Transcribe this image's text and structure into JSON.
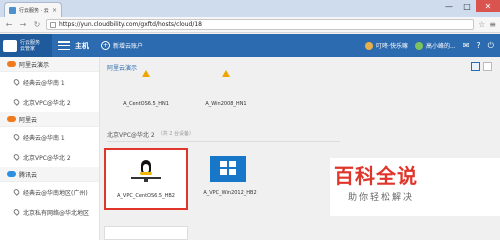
{
  "browser": {
    "tab_title": "行云服务 · 云管家",
    "tab_close": "×",
    "url": "https://yun.cloudbility.com/gxftd/hosts/cloud/18",
    "window_controls": [
      "—",
      "□",
      "✕"
    ],
    "icons": {
      "back": "back-arrow-icon",
      "forward": "forward-arrow-icon",
      "reload": "reload-icon",
      "bookmark": "star-icon",
      "menu": "menu-icon"
    }
  },
  "app": {
    "logo_text_1": "行云服务",
    "logo_text_2": "云管家",
    "host_label": "主机",
    "new_host": "新增云账户",
    "user_label": "叮咚·快乐嘛",
    "account_label": "高小峰的...",
    "notify_icon": "mail-icon",
    "help_icon": "help-icon",
    "power_icon": "power-icon"
  },
  "sidebar": {
    "groups": [
      {
        "label": "阿里云演示",
        "color": "#f07a1e",
        "items": [
          {
            "label": "经典云@华南 1"
          },
          {
            "label": "北京VPC@华北 2"
          }
        ]
      },
      {
        "label": "阿里云",
        "color": "#f07a1e",
        "items": [
          {
            "label": "经典云@华南 1"
          },
          {
            "label": "北京VPC@华北 2"
          }
        ]
      },
      {
        "label": "腾讯云",
        "color": "#2d8fe0",
        "items": [
          {
            "label": "经典云@华南地区(广州)"
          },
          {
            "label": "北京私有网络@华北地区"
          }
        ]
      }
    ]
  },
  "main": {
    "crumb": "阿里云演示",
    "top_hosts": [
      {
        "label": "A_CentOS6.5_HN1"
      },
      {
        "label": "A_Win2008_HN1"
      }
    ],
    "section_title": "北京VPC@华北 2",
    "section_count": "（共 2 台设备）",
    "vpc_hosts": [
      {
        "label": "A_VPC_CentOS6.5_HB2"
      },
      {
        "label": "A_VPC_Win2012_HB2"
      }
    ]
  },
  "watermark": {
    "big": "百科全说",
    "small": "助你轻松解决"
  }
}
